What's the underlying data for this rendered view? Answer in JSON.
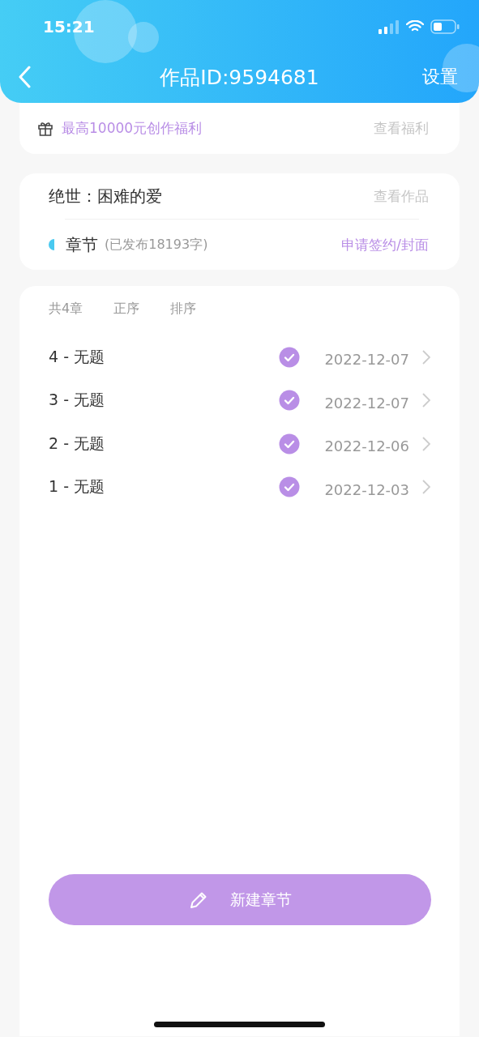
{
  "status_bar": {
    "time": "15:21"
  },
  "nav": {
    "title": "作品ID:9594681",
    "action": "设置"
  },
  "promo": {
    "text": "最高10000元创作福利",
    "link": "查看福利"
  },
  "work": {
    "title": "绝世：困难的爱",
    "link": "查看作品",
    "section": "章节",
    "section_note": "(已发布18193字)",
    "action": "申请签约/封面"
  },
  "chapter_toolbar": [
    {
      "label": "共4章"
    },
    {
      "label": "正序"
    },
    {
      "label": "排序"
    }
  ],
  "chapters": [
    {
      "title": "4 - 无题",
      "published": true,
      "date": "2022-12-07"
    },
    {
      "title": "3 - 无题",
      "published": true,
      "date": "2022-12-07"
    },
    {
      "title": "2 - 无题",
      "published": true,
      "date": "2022-12-06"
    },
    {
      "title": "1 - 无题",
      "published": true,
      "date": "2022-12-03"
    }
  ],
  "new_button": {
    "label": "新建章节"
  }
}
